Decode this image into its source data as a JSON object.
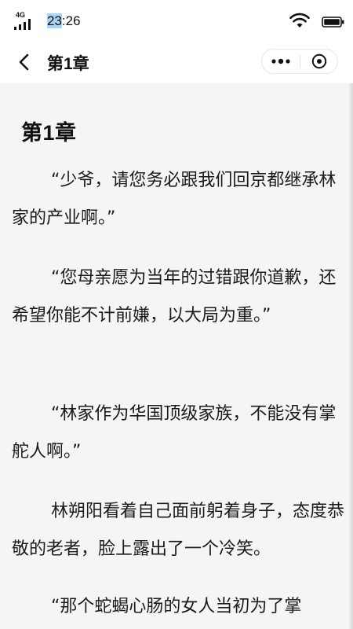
{
  "status_bar": {
    "network": "4G",
    "time_hour": "23",
    "time_rest": ":26"
  },
  "nav": {
    "title": "第1章"
  },
  "content": {
    "chapter_heading": "第1章",
    "paragraphs": [
      "“少爷，请您务必跟我们回京都继承林家的产业啊。”",
      "“您母亲愿为当年的过错跟你道歉，还希望你能不计前嫌，以大局为重。”",
      "“林家作为华国顶级家族，不能没有掌舵人啊。”",
      "林朔阳看着自己面前躬着身子，态度恭敬的老者，脸上露出了一个冷笑。",
      "“那个蛇蝎心肠的女人当初为了掌"
    ]
  },
  "colors": {
    "background": "#f5f5f5",
    "bar": "#ffffff",
    "time_highlight": "#aad4f5"
  }
}
